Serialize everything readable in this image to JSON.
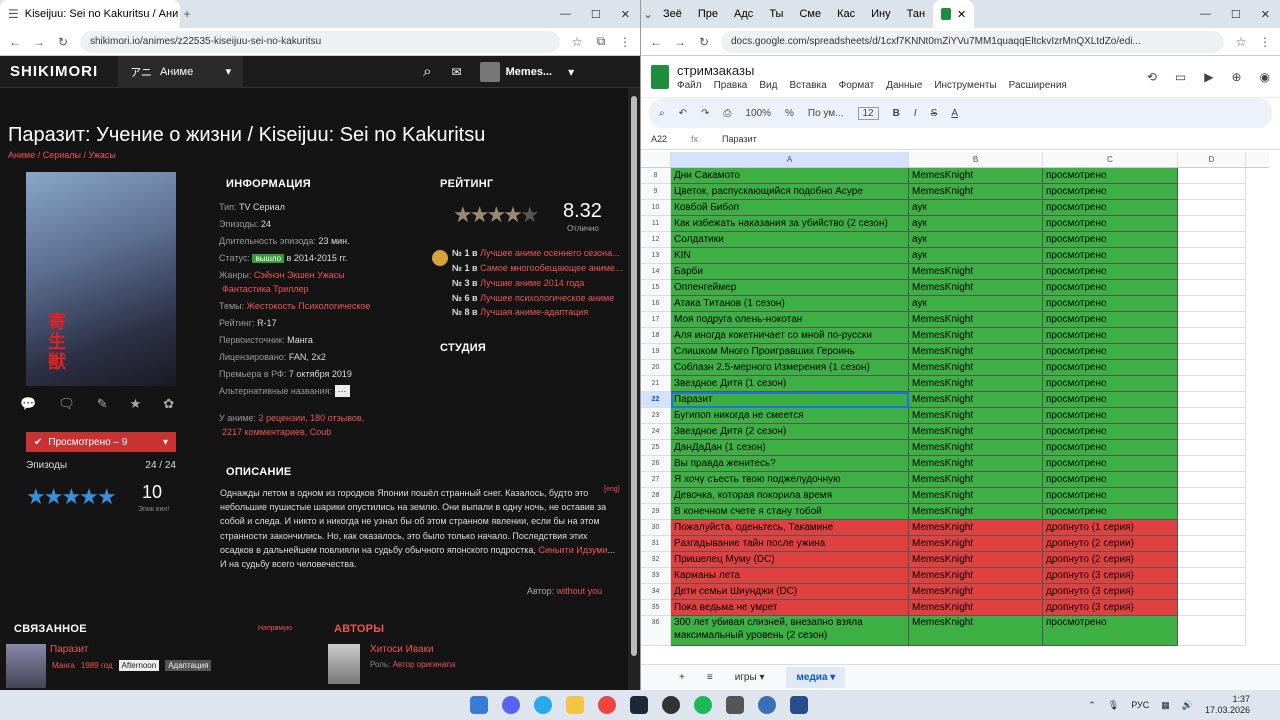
{
  "left_browser": {
    "tab_title": "Kiseijuu: Sei no Kakuritsu / Ани",
    "url": "shikimori.io/animes/z22535-kiseijuu-sei-no-kakuritsu"
  },
  "shikimori": {
    "logo": "SHIKIMORI",
    "section_icon": "アニ",
    "section": "Аниме",
    "user": "Memes...",
    "title": "Паразит: Учение о жизни / Kiseijuu: Sei no Kakuritsu",
    "breadcrumbs": "Аниме / Сериалы / Ужасы",
    "poster_kanji": "寄生獣",
    "watched_btn": "Просмотрено – 9",
    "episodes_label": "Эпизоды",
    "episodes_value": "24 / 24",
    "my_score": "10",
    "my_score_label": "Эпик вин!",
    "info_heading": "ИНФОРМАЦИЯ",
    "info": {
      "type_label": "Тип:",
      "type": "TV Сериал",
      "eps_label": "Эпизоды:",
      "eps": "24",
      "dur_label": "Длительность эпизода:",
      "dur": "23 мин.",
      "status_label": "Статус:",
      "status_badge": "вышло",
      "status_years": "в 2014-2015 гг.",
      "genres_label": "Жанры:",
      "genres1": "Сэйнэн  Экшен  Ужасы",
      "genres2": "Фантастика  Триллер",
      "themes_label": "Темы:",
      "themes": "Жестокость  Психологическое",
      "rating_label": "Рейтинг:",
      "rating": "R-17",
      "source_label": "Первоисточник:",
      "source": "Манга",
      "license_label": "Лицензировано:",
      "license": "FAN, 2x2",
      "premiere_label": "Премьера в РФ:",
      "premiere": "7 октября 2019",
      "alt_label": "Альтернативные названия:",
      "alt": "···",
      "stats_prefix": "У аниме:",
      "stats1": "2 рецензии, 180 отзывов,",
      "stats2": "2217 комментариев, Coub"
    },
    "rating_heading": "РЕЙТИНГ",
    "rating_score": "8.32",
    "rating_word": "Отлично",
    "ranks": [
      {
        "prefix": "№ 1 в",
        "text": "Лучшее аниме осеннего сезона..."
      },
      {
        "prefix": "№ 1 в",
        "text": "Самое многообещающее аниме..."
      },
      {
        "prefix": "№ 3 в",
        "text": "Лучшие аниме 2014 года"
      },
      {
        "prefix": "№ 6 в",
        "text": "Лучшее психологическое аниме"
      },
      {
        "prefix": "№ 8 в",
        "text": "Лучшая аниме-адаптация"
      }
    ],
    "studio_heading": "СТУДИЯ",
    "desc_heading": "ОПИСАНИЕ",
    "desc_eng": "[eng]",
    "desc_main": "Однажды летом в одном из городков Японии пошёл странный снег. Казалось, будто это небольшие пушистые шарики опустились на землю. Они выпали в одну ночь, не оставив за собой и следа. И никто и никогда не узнал бы об этом странном явлении, если бы на этом странности закончились. Но, как оказалось, это было только начало. Последствия этих осадков в дальнейшем повлияли на судьбу обычного японского подростка, ",
    "desc_link": "Синьити Идзуми",
    "desc_end": "... И на судьбу всего человечества.",
    "author_label": "Автор:",
    "author_name": "without you",
    "related_heading": "СВЯЗАННОЕ",
    "related_direct": "Напрямую",
    "related_title": "Паразит",
    "related_kind": "Манга",
    "related_year": "1989 год",
    "related_tag1": "Afternoon",
    "related_tag2": "Адаптация",
    "authors_heading": "АВТОРЫ",
    "author_person": "Хитоси Иваки",
    "author_role_label": "Роль:",
    "author_role": "Автор оригинала"
  },
  "right_browser": {
    "tabs": [
      "Зеё",
      "Пре",
      "Адс",
      "Ты ",
      "Сме",
      "Кас",
      "Ину",
      "Тан"
    ],
    "url": "docs.google.com/spreadsheets/d/1cxf7KNNt0mZiYVu7MM1quaqqEltckvIzrMnQXLtdZo/edi..."
  },
  "sheets": {
    "doc_title": "стримзаказы",
    "menus": [
      "Файл",
      "Правка",
      "Вид",
      "Вставка",
      "Формат",
      "Данные",
      "Инструменты",
      "Расширения"
    ],
    "zoom": "100%",
    "font": "По ум...",
    "font_size": "12",
    "cell_ref": "A22",
    "formula": "Паразит",
    "columns": [
      "A",
      "B",
      "C",
      "D"
    ],
    "rows": [
      {
        "n": "8",
        "a": "Дни Сакамото",
        "b": "MemesKnight",
        "c": "просмотрено",
        "s": "g"
      },
      {
        "n": "9",
        "a": "Цветок, распускающийся подобно Асуре",
        "b": "MemesKnight",
        "c": "просмотрено",
        "s": "g"
      },
      {
        "n": "10",
        "a": "Ковбой Бибоп",
        "b": "аук",
        "c": "просмотрено",
        "s": "g"
      },
      {
        "n": "11",
        "a": "Как избежать наказания за убийство (2 сезон)",
        "b": "аук",
        "c": "просмотрено",
        "s": "g"
      },
      {
        "n": "12",
        "a": "Солдатики",
        "b": "аук",
        "c": "просмотрено",
        "s": "g"
      },
      {
        "n": "13",
        "a": "KIN",
        "b": "аук",
        "c": "просмотрено",
        "s": "g"
      },
      {
        "n": "14",
        "a": "Барби",
        "b": "MemesKnight",
        "c": "просмотрено",
        "s": "g"
      },
      {
        "n": "15",
        "a": "Оппенгеймер",
        "b": "MemesKnight",
        "c": "просмотрено",
        "s": "g"
      },
      {
        "n": "16",
        "a": "Атака Титанов (1 сезон)",
        "b": "аук",
        "c": "просмотрено",
        "s": "g"
      },
      {
        "n": "17",
        "a": "Моя подруга олень-нокотан",
        "b": "MemesKnight",
        "c": "просмотрено",
        "s": "g"
      },
      {
        "n": "18",
        "a": "Аля иногда кокетничает со мной по-русски",
        "b": "MemesKnight",
        "c": "просмотрено",
        "s": "g"
      },
      {
        "n": "19",
        "a": "Слишком Много Проигравших Героинь",
        "b": "MemesKnight",
        "c": "просмотрено",
        "s": "g"
      },
      {
        "n": "20",
        "a": "Соблазн 2.5-мерного Измерения (1 сезон)",
        "b": "MemesKnight",
        "c": "просмотрено",
        "s": "g"
      },
      {
        "n": "21",
        "a": "Звездное Дитя (1 сезон)",
        "b": "MemesKnight",
        "c": "просмотрено",
        "s": "g"
      },
      {
        "n": "22",
        "a": "Паразит",
        "b": "MemesKnight",
        "c": "просмотрено",
        "s": "g"
      },
      {
        "n": "23",
        "a": "Бугипоп никогда не смеется",
        "b": "MemesKnight",
        "c": "просмотрено",
        "s": "g"
      },
      {
        "n": "24",
        "a": "Звездное Дитя (2 сезон)",
        "b": "MemesKnight",
        "c": "просмотрено",
        "s": "g"
      },
      {
        "n": "25",
        "a": "ДанДаДан (1 сезон)",
        "b": "MemesKnight",
        "c": "просмотрено",
        "s": "g"
      },
      {
        "n": "26",
        "a": "Вы правда женитесь?",
        "b": "MemesKnight",
        "c": "просмотрено",
        "s": "g"
      },
      {
        "n": "27",
        "a": "Я хочу съесть твою поджелудочную",
        "b": "MemesKnight",
        "c": "просмотрено",
        "s": "g"
      },
      {
        "n": "28",
        "a": "Девочка, которая покорила время",
        "b": "MemesKnight",
        "c": "просмотрено",
        "s": "g"
      },
      {
        "n": "29",
        "a": "В конечном счете я стану тобой",
        "b": "MemesKnight",
        "c": "просмотрено",
        "s": "g"
      },
      {
        "n": "30",
        "a": "Пожалуйста, оденьтесь, Такамине",
        "b": "MemesKnight",
        "c": "дропнуто (1 серия)",
        "s": "r"
      },
      {
        "n": "31",
        "a": "Разгадывание тайн после ужина",
        "b": "MemesKnight",
        "c": "дропнуто (2 серии)",
        "s": "r"
      },
      {
        "n": "32",
        "a": "Пришелец Муму (DC)",
        "b": "MemesKnight",
        "c": "дропнуто (2 серия)",
        "s": "r"
      },
      {
        "n": "33",
        "a": "Карманы лета",
        "b": "MemesKnight",
        "c": "дропнуто (3 серия)",
        "s": "r"
      },
      {
        "n": "34",
        "a": "Дети семьи Шиунджи (DC)",
        "b": "MemesKnight",
        "c": "дропнуто (3 серия)",
        "s": "r"
      },
      {
        "n": "35",
        "a": "Пока ведьма не умрет",
        "b": "MemesKnight",
        "c": "дропнуто (3 серия)",
        "s": "r"
      },
      {
        "n": "36",
        "a": "300 лет убивая слизней, внезапно взяла максимальный уровень (2 сезон)",
        "b": "MemesKnight",
        "c": "просмотрено",
        "s": "g",
        "tall": true
      }
    ],
    "sheet_tabs": [
      "игры",
      "медиа"
    ]
  },
  "taskbar": {
    "lang": "РУС",
    "time": "1:37",
    "date": "17.03.2026"
  }
}
